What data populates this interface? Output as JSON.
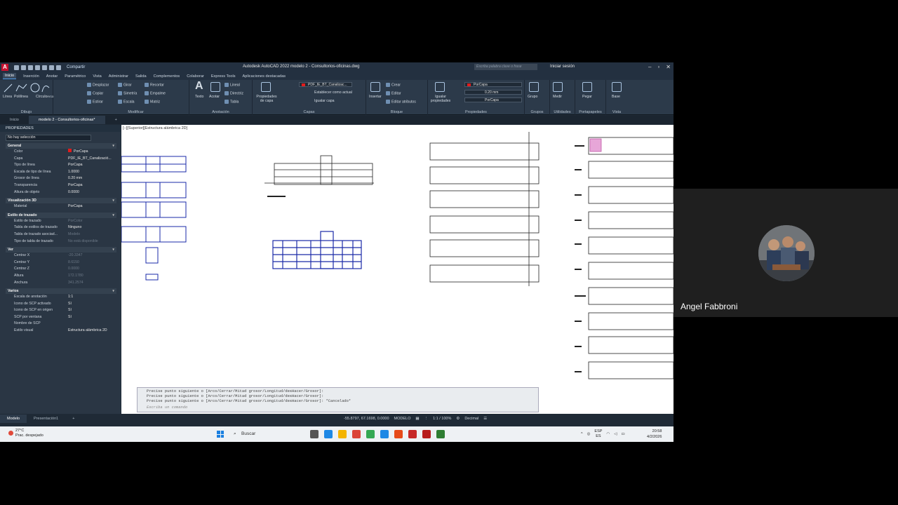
{
  "app": {
    "title": "Autodesk AutoCAD 2022   modelo 2 - Consultorios-oficinas.dwg",
    "share": "Compartir",
    "search_placeholder": "Escriba palabra clave o frase",
    "signin": "Iniciar sesión"
  },
  "ribbon_tabs": [
    "Inicio",
    "Inserción",
    "Anotar",
    "Paramétrico",
    "Vista",
    "Administrar",
    "Salida",
    "Complementos",
    "Colaborar",
    "Express Tools",
    "Aplicaciones destacadas"
  ],
  "ribbon": {
    "dibujo": {
      "title": "Dibujo",
      "linea": "Línea",
      "polilinea": "Polilínea",
      "circulo": "Círculo",
      "arco": "Arco"
    },
    "modificar": {
      "title": "Modificar",
      "desplazar": "Desplazar",
      "girar": "Girar",
      "recortar": "Recortar",
      "copiar": "Copiar",
      "simetria": "Simetría",
      "empalme": "Empalme",
      "estirar": "Estirar",
      "escala": "Escala",
      "matriz": "Matriz"
    },
    "anotacion": {
      "title": "Anotación",
      "texto": "Texto",
      "acotar": "Acotar",
      "lineal": "Lineal",
      "directriz": "Directriz",
      "tabla": "Tabla"
    },
    "capas": {
      "title": "Capas",
      "propiedades": "Propiedades de capa",
      "layer": "PDF_IE_BT_Canalizac...",
      "establecer": "Establecer como actual",
      "igualar": "Igualar capa"
    },
    "bloque": {
      "title": "Bloque",
      "insertar": "Insertar",
      "crear": "Crear",
      "editar": "Editar",
      "editar_atributos": "Editar atributos"
    },
    "propiedades": {
      "title": "Propiedades",
      "igualar": "Igualar propiedades",
      "color": "PorCapa",
      "grosor": "0.20 mm",
      "tipo": "PorCapa"
    },
    "grupos": {
      "title": "Grupos",
      "grupo": "Grupo"
    },
    "utilidades": {
      "title": "Utilidades",
      "medir": "Medir"
    },
    "portapapeles": {
      "title": "Portapapeles",
      "pegar": "Pegar"
    },
    "vista": {
      "title": "Vista",
      "base": "Base"
    }
  },
  "doc_tabs": {
    "inicio": "Inicio",
    "active": "modelo 2 - Consultorios-oficinas*"
  },
  "properties": {
    "header": "PROPIEDADES",
    "selection": "No hay selección",
    "sections": [
      {
        "name": "General",
        "rows": [
          {
            "k": "Color",
            "v": "PorCapa"
          },
          {
            "k": "Capa",
            "v": "PDF_IE_BT_Canalizació..."
          },
          {
            "k": "Tipo de línea",
            "v": "PorCapa"
          },
          {
            "k": "Escala de tipo de línea",
            "v": "1.0000"
          },
          {
            "k": "Grosor de línea",
            "v": "0.20 mm"
          },
          {
            "k": "Transparencia",
            "v": "PorCapa"
          },
          {
            "k": "Altura de objeto",
            "v": "0.0000"
          }
        ]
      },
      {
        "name": "Visualización 3D",
        "rows": [
          {
            "k": "Material",
            "v": "PorCapa"
          }
        ]
      },
      {
        "name": "Estilo de trazado",
        "rows": [
          {
            "k": "Estilo de trazado",
            "v": "PorColor"
          },
          {
            "k": "Tabla de estilos de trazado",
            "v": "Ninguno"
          },
          {
            "k": "Tabla de trazado asociad...",
            "v": "Modelo"
          },
          {
            "k": "Tipo de tabla de trazado",
            "v": "No está disponible"
          }
        ]
      },
      {
        "name": "Ver",
        "rows": [
          {
            "k": "Centrar X",
            "v": "-20.3347"
          },
          {
            "k": "Centrar Y",
            "v": "8.6150"
          },
          {
            "k": "Centrar Z",
            "v": "0.0000"
          },
          {
            "k": "Altura",
            "v": "172.1780"
          },
          {
            "k": "Anchura",
            "v": "341.2574"
          }
        ]
      },
      {
        "name": "Varios",
        "rows": [
          {
            "k": "Escala de anotación",
            "v": "1:1"
          },
          {
            "k": "Icono de SCP activado",
            "v": "Sí"
          },
          {
            "k": "Icono de SCP en origen",
            "v": "Sí"
          },
          {
            "k": "SCP por ventana",
            "v": "Sí"
          },
          {
            "k": "Nombre de SCP",
            "v": ""
          },
          {
            "k": "Estilo visual",
            "v": "Estructura alámbrica 2D"
          }
        ]
      }
    ]
  },
  "viewport_label": "[−][Superior][Estructura alámbrica 2D]",
  "command_lines": [
    "Precise punto siguiente o [Arco/Cerrar/Mitad grosor/Longitud/desHacer/Grosor]:",
    "Precise punto siguiente o [Arco/Cerrar/Mitad grosor/Longitud/desHacer/Grosor]:",
    "Precise punto siguiente o [Arco/Cerrar/Mitad grosor/Longitud/desHacer/Grosor]: *Cancelado*"
  ],
  "command_placeholder": "Escriba un comando",
  "model_tabs": {
    "modelo": "Modelo",
    "presentacion": "Presentación1"
  },
  "status": {
    "coords": "-55.8797, 67.1698, 0.0000",
    "mode": "MODELO",
    "scale": "1:1 / 100%",
    "units": "Decimal"
  },
  "taskbar": {
    "temp": "27°C",
    "weather": "Prac. despejado",
    "search": "Buscar",
    "lang": "ESP",
    "region": "ES",
    "time": "20:58",
    "date": "4/2/2026"
  },
  "participant": {
    "name": "Angel Fabbroni"
  },
  "colors": {
    "layer_red": "#e21b1b",
    "accent": "#4c9be8",
    "drawing_blue": "#1a2aa8"
  }
}
